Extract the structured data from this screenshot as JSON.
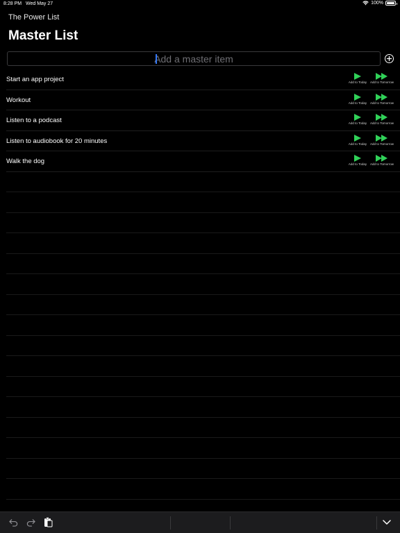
{
  "status": {
    "time": "8:28 PM",
    "date": "Wed May 27",
    "battery": "100%",
    "icons": [
      "wifi-icon",
      "battery-icon"
    ]
  },
  "app": {
    "name": "The Power List",
    "title": "Master List"
  },
  "input": {
    "placeholder": "Add a master item",
    "value": ""
  },
  "actions": {
    "today_label": "Add to Today",
    "tomorrow_label": "Add to Tomorrow"
  },
  "items": [
    {
      "label": "Start an app project"
    },
    {
      "label": "Workout"
    },
    {
      "label": "Listen to a podcast"
    },
    {
      "label": "Listen to audiobook for 20 minutes"
    },
    {
      "label": "Walk the dog"
    }
  ],
  "colors": {
    "accent_green": "#30d158",
    "caret_blue": "#3478f6",
    "background": "#000000"
  },
  "keyboard_bar": {
    "icons": [
      "undo-icon",
      "redo-icon",
      "paste-icon",
      "dismiss-keyboard-icon"
    ]
  }
}
